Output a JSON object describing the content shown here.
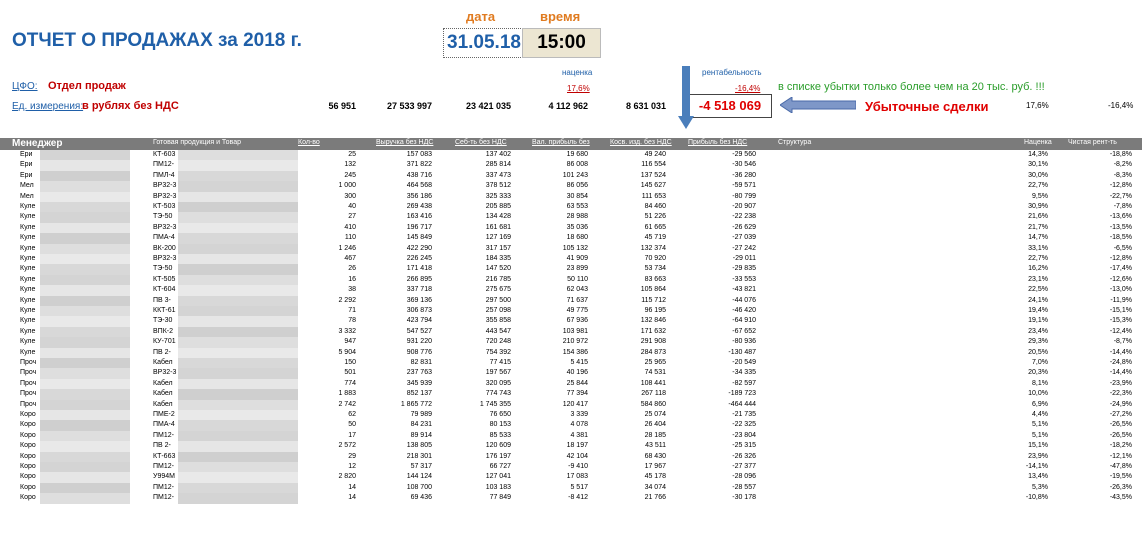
{
  "header": {
    "title": "ОТЧЕТ О ПРОДАЖАХ за 2018 г.",
    "date_label": "дата",
    "time_label": "время",
    "date": "31.05.18",
    "time": "15:00",
    "cfo_label": "ЦФО:",
    "cfo_value": "Отдел продаж",
    "unit_label": "Ед. измерения:",
    "unit_value": "в рублях без НДС",
    "nacenka_label": "наценка",
    "nacenka_value": "17,6%",
    "rent_label": "рентабельность",
    "rent_value": "-16,4%",
    "note": "в списке убытки только более чем на 20 тыс. руб. !!!",
    "loss_total": "-4 518 069",
    "loss_label": "Убыточные сделки",
    "totals": [
      "56 951",
      "27 533 997",
      "23 421 035",
      "4 112 962",
      "8 631 031"
    ],
    "total_pct_nacenka": "17,6%",
    "total_pct_rent": "-16,4%"
  },
  "columns": [
    "Менеджер",
    "Готовая продукция и Товар",
    "Кол-во",
    "Выручка без НДС",
    "Себ-ть без НДС",
    "Вал. прибыль без",
    "Косв. изд. без НДС",
    "Прибыль без НДС",
    "Структура",
    "Наценка",
    "Чистая рент-ть"
  ],
  "rows": [
    {
      "m": "Ери",
      "p": "КТ-603",
      "q": "25",
      "rev": "157 083",
      "cost": "137 402",
      "gp": "19 680",
      "ind": "49 240",
      "pr": "-29 560",
      "n": "14,3%",
      "rent": "-18,8%"
    },
    {
      "m": "Ери",
      "p": "ПМ12-",
      "q": "132",
      "rev": "371 822",
      "cost": "285 814",
      "gp": "86 008",
      "ind": "116 554",
      "pr": "-30 546",
      "n": "30,1%",
      "rent": "-8,2%"
    },
    {
      "m": "Ери",
      "p": "ПМЛ-4",
      "q": "245",
      "rev": "438 716",
      "cost": "337 473",
      "gp": "101 243",
      "ind": "137 524",
      "pr": "-36 280",
      "n": "30,0%",
      "rent": "-8,3%"
    },
    {
      "m": "Мел",
      "p": "ВР32-3",
      "q": "1 000",
      "rev": "464 568",
      "cost": "378 512",
      "gp": "86 056",
      "ind": "145 627",
      "pr": "-59 571",
      "n": "22,7%",
      "rent": "-12,8%"
    },
    {
      "m": "Мел",
      "p": "ВР32-3",
      "q": "300",
      "rev": "356 186",
      "cost": "325 333",
      "gp": "30 854",
      "ind": "111 653",
      "pr": "-80 799",
      "n": "9,5%",
      "rent": "-22,7%"
    },
    {
      "m": "Куле",
      "p": "КТ-503",
      "q": "40",
      "rev": "269 438",
      "cost": "205 885",
      "gp": "63 553",
      "ind": "84 460",
      "pr": "-20 907",
      "n": "30,9%",
      "rent": "-7,8%"
    },
    {
      "m": "Куле",
      "p": "ТЭ-50",
      "q": "27",
      "rev": "163 416",
      "cost": "134 428",
      "gp": "28 988",
      "ind": "51 226",
      "pr": "-22 238",
      "n": "21,6%",
      "rent": "-13,6%"
    },
    {
      "m": "Куле",
      "p": "ВР32-3",
      "q": "410",
      "rev": "196 717",
      "cost": "161 681",
      "gp": "35 036",
      "ind": "61 665",
      "pr": "-26 629",
      "n": "21,7%",
      "rent": "-13,5%"
    },
    {
      "m": "Куле",
      "p": "ПМА-4",
      "q": "110",
      "rev": "145 849",
      "cost": "127 169",
      "gp": "18 680",
      "ind": "45 719",
      "pr": "-27 039",
      "n": "14,7%",
      "rent": "-18,5%"
    },
    {
      "m": "Куле",
      "p": "ВК-200",
      "q": "1 246",
      "rev": "422 290",
      "cost": "317 157",
      "gp": "105 132",
      "ind": "132 374",
      "pr": "-27 242",
      "n": "33,1%",
      "rent": "-6,5%"
    },
    {
      "m": "Куле",
      "p": "ВР32-3",
      "q": "467",
      "rev": "226 245",
      "cost": "184 335",
      "gp": "41 909",
      "ind": "70 920",
      "pr": "-29 011",
      "n": "22,7%",
      "rent": "-12,8%"
    },
    {
      "m": "Куле",
      "p": "ТЭ-50",
      "q": "26",
      "rev": "171 418",
      "cost": "147 520",
      "gp": "23 899",
      "ind": "53 734",
      "pr": "-29 835",
      "n": "16,2%",
      "rent": "-17,4%"
    },
    {
      "m": "Куле",
      "p": "КТ-505",
      "q": "16",
      "rev": "266 895",
      "cost": "216 785",
      "gp": "50 110",
      "ind": "83 663",
      "pr": "-33 553",
      "n": "23,1%",
      "rent": "-12,6%"
    },
    {
      "m": "Куле",
      "p": "КТ-604",
      "q": "38",
      "rev": "337 718",
      "cost": "275 675",
      "gp": "62 043",
      "ind": "105 864",
      "pr": "-43 821",
      "n": "22,5%",
      "rent": "-13,0%"
    },
    {
      "m": "Куле",
      "p": "ПВ 3-",
      "q": "2 292",
      "rev": "369 136",
      "cost": "297 500",
      "gp": "71 637",
      "ind": "115 712",
      "pr": "-44 076",
      "n": "24,1%",
      "rent": "-11,9%"
    },
    {
      "m": "Куле",
      "p": "ККТ-61",
      "q": "71",
      "rev": "306 873",
      "cost": "257 098",
      "gp": "49 775",
      "ind": "96 195",
      "pr": "-46 420",
      "n": "19,4%",
      "rent": "-15,1%"
    },
    {
      "m": "Куле",
      "p": "ТЭ-30",
      "q": "78",
      "rev": "423 794",
      "cost": "355 858",
      "gp": "67 936",
      "ind": "132 846",
      "pr": "-64 910",
      "n": "19,1%",
      "rent": "-15,3%"
    },
    {
      "m": "Куле",
      "p": "ВПК-2",
      "q": "3 332",
      "rev": "547 527",
      "cost": "443 547",
      "gp": "103 981",
      "ind": "171 632",
      "pr": "-67 652",
      "n": "23,4%",
      "rent": "-12,4%"
    },
    {
      "m": "Куле",
      "p": "КУ-701",
      "q": "947",
      "rev": "931 220",
      "cost": "720 248",
      "gp": "210 972",
      "ind": "291 908",
      "pr": "-80 936",
      "n": "29,3%",
      "rent": "-8,7%"
    },
    {
      "m": "Куле",
      "p": "ПВ 2-",
      "q": "5 904",
      "rev": "908 776",
      "cost": "754 392",
      "gp": "154 386",
      "ind": "284 873",
      "pr": "-130 487",
      "n": "20,5%",
      "rent": "-14,4%"
    },
    {
      "m": "Проч",
      "p": "Кабел",
      "q": "150",
      "rev": "82 831",
      "cost": "77 415",
      "gp": "5 415",
      "ind": "25 965",
      "pr": "-20 549",
      "n": "7,0%",
      "rent": "-24,8%"
    },
    {
      "m": "Проч",
      "p": "ВР32-3",
      "q": "501",
      "rev": "237 763",
      "cost": "197 567",
      "gp": "40 196",
      "ind": "74 531",
      "pr": "-34 335",
      "n": "20,3%",
      "rent": "-14,4%"
    },
    {
      "m": "Проч",
      "p": "Кабел",
      "q": "774",
      "rev": "345 939",
      "cost": "320 095",
      "gp": "25 844",
      "ind": "108 441",
      "pr": "-82 597",
      "n": "8,1%",
      "rent": "-23,9%"
    },
    {
      "m": "Проч",
      "p": "Кабел",
      "q": "1 883",
      "rev": "852 137",
      "cost": "774 743",
      "gp": "77 394",
      "ind": "267 118",
      "pr": "-189 723",
      "n": "10,0%",
      "rent": "-22,3%"
    },
    {
      "m": "Проч",
      "p": "Кабел",
      "q": "2 742",
      "rev": "1 865 772",
      "cost": "1 745 355",
      "gp": "120 417",
      "ind": "584 860",
      "pr": "-464 444",
      "n": "6,9%",
      "rent": "-24,9%"
    },
    {
      "m": "Коро",
      "p": "ПМЕ-2",
      "q": "62",
      "rev": "79 989",
      "cost": "76 650",
      "gp": "3 339",
      "ind": "25 074",
      "pr": "-21 735",
      "n": "4,4%",
      "rent": "-27,2%"
    },
    {
      "m": "Коро",
      "p": "ПМА-4",
      "q": "50",
      "rev": "84 231",
      "cost": "80 153",
      "gp": "4 078",
      "ind": "26 404",
      "pr": "-22 325",
      "n": "5,1%",
      "rent": "-26,5%"
    },
    {
      "m": "Коро",
      "p": "ПМ12-",
      "q": "17",
      "rev": "89 914",
      "cost": "85 533",
      "gp": "4 381",
      "ind": "28 185",
      "pr": "-23 804",
      "n": "5,1%",
      "rent": "-26,5%"
    },
    {
      "m": "Коро",
      "p": "ПВ 2-",
      "q": "2 572",
      "rev": "138 805",
      "cost": "120 609",
      "gp": "18 197",
      "ind": "43 511",
      "pr": "-25 315",
      "n": "15,1%",
      "rent": "-18,2%"
    },
    {
      "m": "Коро",
      "p": "КТ-663",
      "q": "29",
      "rev": "218 301",
      "cost": "176 197",
      "gp": "42 104",
      "ind": "68 430",
      "pr": "-26 326",
      "n": "23,9%",
      "rent": "-12,1%"
    },
    {
      "m": "Коро",
      "p": "ПМ12-",
      "q": "12",
      "rev": "57 317",
      "cost": "66 727",
      "gp": "-9 410",
      "ind": "17 967",
      "pr": "-27 377",
      "n": "-14,1%",
      "rent": "-47,8%"
    },
    {
      "m": "Коро",
      "p": "У994М",
      "q": "2 820",
      "rev": "144 124",
      "cost": "127 041",
      "gp": "17 083",
      "ind": "45 178",
      "pr": "-28 096",
      "n": "13,4%",
      "rent": "-19,5%"
    },
    {
      "m": "Коро",
      "p": "ПМ12-",
      "q": "14",
      "rev": "108 700",
      "cost": "103 183",
      "gp": "5 517",
      "ind": "34 074",
      "pr": "-28 557",
      "n": "5,3%",
      "rent": "-26,3%"
    },
    {
      "m": "Коро",
      "p": "ПМ12-",
      "q": "14",
      "rev": "69 436",
      "cost": "77 849",
      "gp": "-8 412",
      "ind": "21 766",
      "pr": "-30 178",
      "n": "-10,8%",
      "rent": "-43,5%"
    }
  ],
  "colors": {
    "accent_blue": "#1f5fa8",
    "red": "#c00000",
    "orange": "#e07b20",
    "green": "#2a9d2a",
    "header_gray": "#7b7b7b"
  }
}
